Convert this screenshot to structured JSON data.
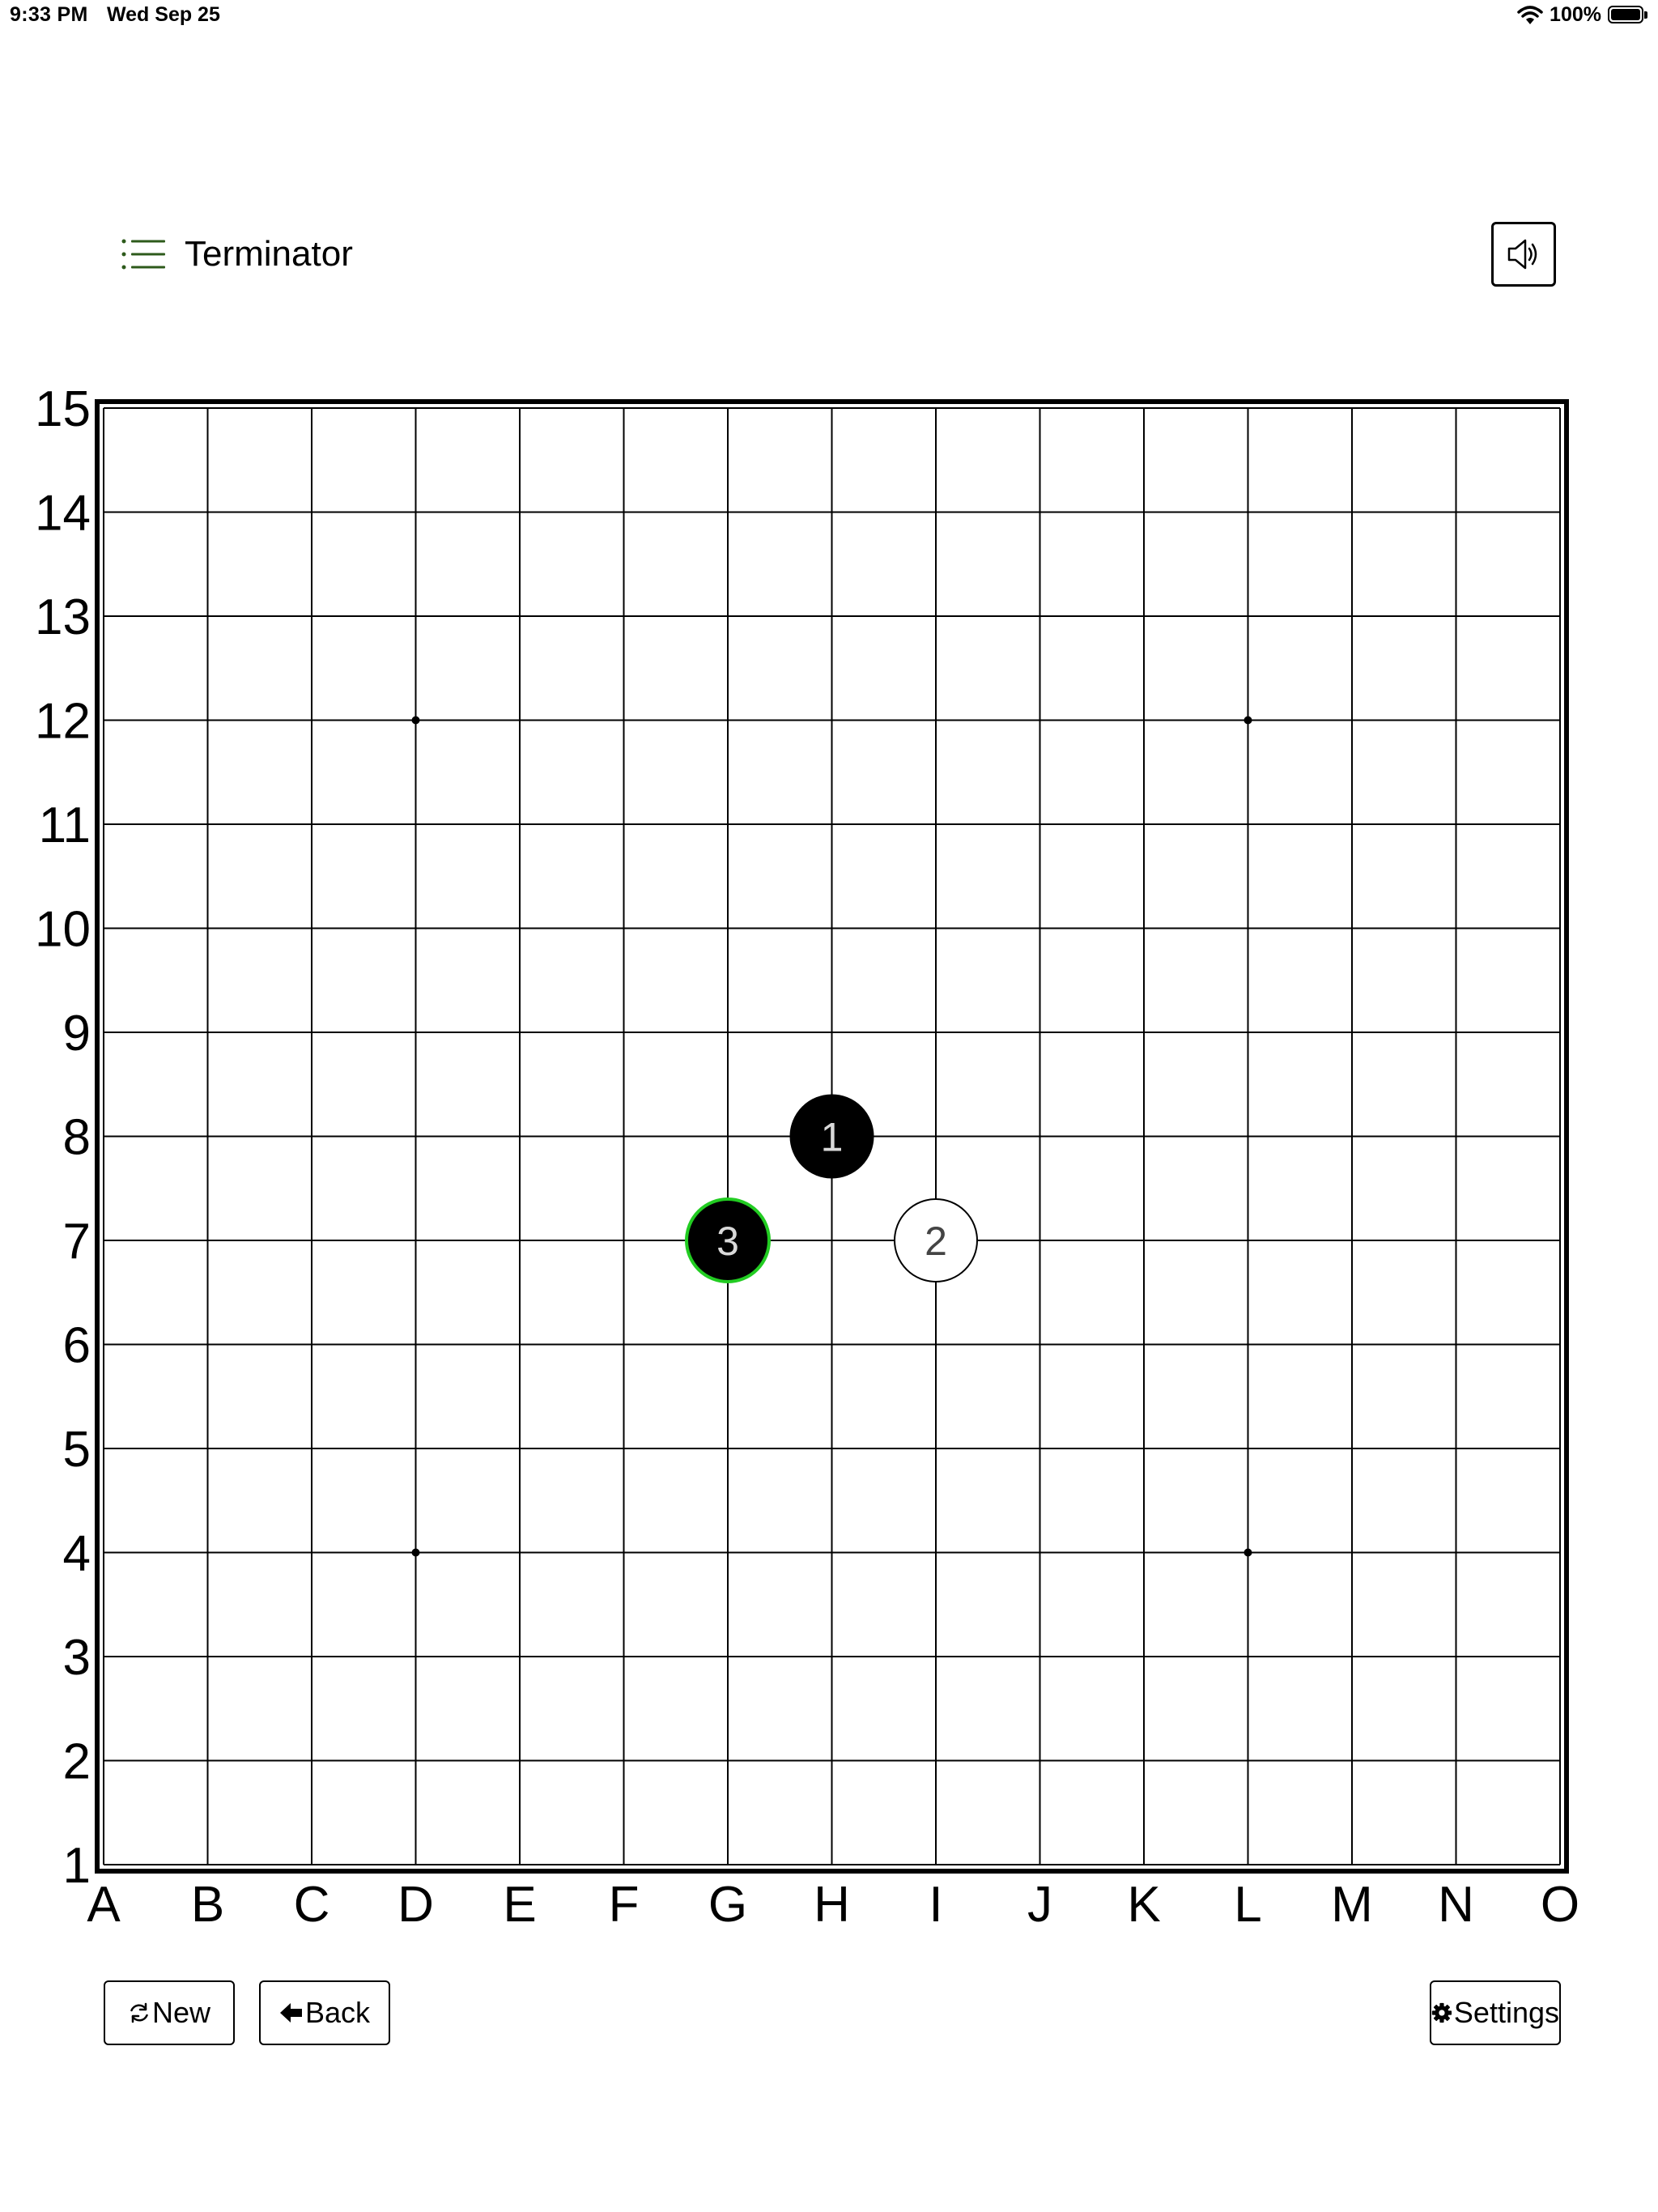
{
  "status_bar": {
    "time": "9:33 PM",
    "date": "Wed Sep 25",
    "battery_percent": "100%",
    "battery_level": 1.0,
    "icons": [
      "wifi-icon",
      "battery-icon"
    ]
  },
  "header": {
    "title": "Terminator",
    "menu_icon": "list-icon",
    "menu_icon_color": "#2d5a1b",
    "sound_icon": "speaker-icon"
  },
  "board": {
    "columns": [
      "A",
      "B",
      "C",
      "D",
      "E",
      "F",
      "G",
      "H",
      "I",
      "J",
      "K",
      "L",
      "M",
      "N",
      "O"
    ],
    "rows": [
      "15",
      "14",
      "13",
      "12",
      "11",
      "10",
      "9",
      "8",
      "7",
      "6",
      "5",
      "4",
      "3",
      "2",
      "1"
    ],
    "star_points": [
      {
        "col": "D",
        "row": "12"
      },
      {
        "col": "L",
        "row": "12"
      },
      {
        "col": "D",
        "row": "4"
      },
      {
        "col": "L",
        "row": "4"
      }
    ],
    "stones": [
      {
        "move": "1",
        "col": "H",
        "row": "8",
        "color": "black"
      },
      {
        "move": "2",
        "col": "I",
        "row": "7",
        "color": "white"
      },
      {
        "move": "3",
        "col": "G",
        "row": "7",
        "color": "black",
        "last_move": true
      }
    ],
    "last_move_highlight_color": "#22cc22"
  },
  "controls": {
    "new_label": "New",
    "new_icon": "refresh-icon",
    "back_label": "Back",
    "back_icon": "arrow-left-icon",
    "settings_label": "Settings",
    "settings_icon": "gear-icon"
  }
}
